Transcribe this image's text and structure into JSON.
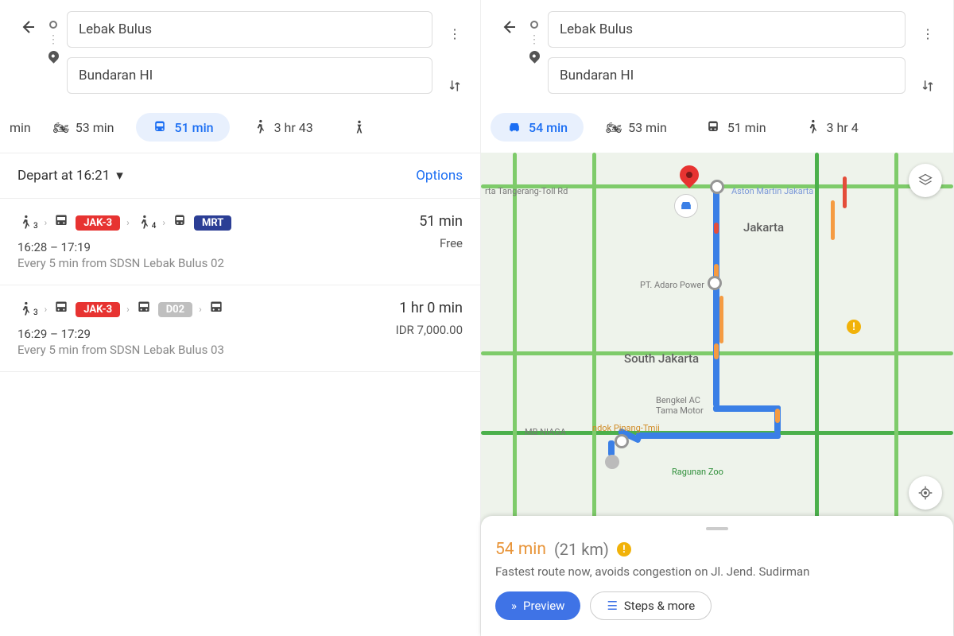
{
  "left": {
    "origin": "Lebak Bulus",
    "destination": "Bundaran HI",
    "modes": {
      "frag": "min",
      "moto": "53 min",
      "transit": "51 min",
      "walk": "3 hr 43"
    },
    "depart": "Depart at 16:21",
    "options": "Options",
    "routes": [
      {
        "walk1": "3",
        "chip1": "JAK-3",
        "walk2": "4",
        "chip2": "MRT",
        "duration": "51 min",
        "time": "16:28 – 17:19",
        "every": "Every 5 min from SDSN Lebak Bulus 02",
        "price": "Free"
      },
      {
        "walk1": "3",
        "chip1": "JAK-3",
        "chip2": "D02",
        "duration": "1 hr 0 min",
        "time": "16:29 – 17:29",
        "every": "Every 5 min from SDSN Lebak Bulus 03",
        "price": "IDR 7,000.00"
      }
    ]
  },
  "right": {
    "origin": "Lebak Bulus",
    "destination": "Bundaran HI",
    "modes": {
      "car": "54 min",
      "moto": "53 min",
      "transit": "51 min",
      "walk": "3 hr 4"
    },
    "poi": {
      "toll": "rta Tangerang-Toll Rd",
      "aston": "Aston Martin Jakarta",
      "jkt": "Jakarta",
      "adaro": "PT. Adaro Power",
      "sjkt": "South Jakarta",
      "bengkel": "Bengkel AC\nTama Motor",
      "niaga": "MB NIAGA",
      "pinang": "ndok Pinang-Tmii",
      "zoo": "Ragunan Zoo"
    },
    "summary": {
      "time": "54 min",
      "dist": "(21 km)"
    },
    "desc": "Fastest route now, avoids congestion on Jl. Jend. Sudirman",
    "preview": "Preview",
    "steps": "Steps & more"
  }
}
